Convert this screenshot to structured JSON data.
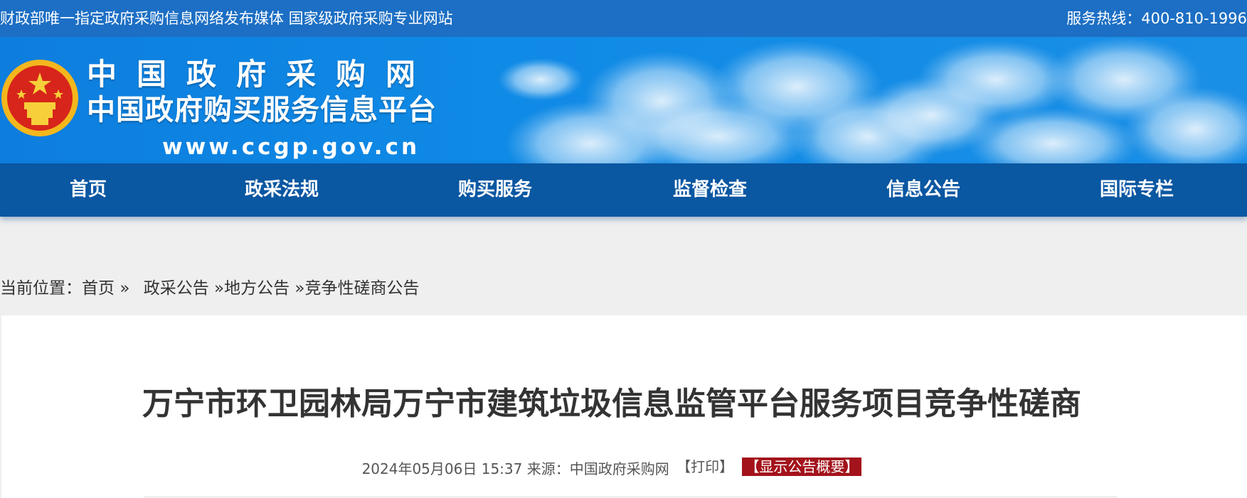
{
  "topbar": {
    "slogan": "财政部唯一指定政府采购信息网络发布媒体 国家级政府采购专业网站",
    "hotline": "服务热线：400-810-1996"
  },
  "banner": {
    "title": "中国政府采购网",
    "subtitle": "中国政府购买服务信息平台",
    "url": "www.ccgp.gov.cn"
  },
  "nav": {
    "items": [
      "首页",
      "政采法规",
      "购买服务",
      "监督检查",
      "信息公告",
      "国际专栏"
    ]
  },
  "breadcrumb": {
    "prefix": "当前位置：",
    "items": [
      "首页",
      "政采公告",
      "地方公告",
      "竞争性磋商公告"
    ],
    "separator": "»"
  },
  "article": {
    "title": "万宁市环卫园林局万宁市建筑垃圾信息监管平台服务项目竞争性磋商",
    "datetime": "2024年05月06日 15:37",
    "source": "来源：中国政府采购网",
    "print_label": "【打印】",
    "summary_label": "【显示公告概要】"
  },
  "colors": {
    "topbar": "#1c6fc4",
    "nav": "#0a57a2",
    "summary_badge": "#a3131b"
  }
}
